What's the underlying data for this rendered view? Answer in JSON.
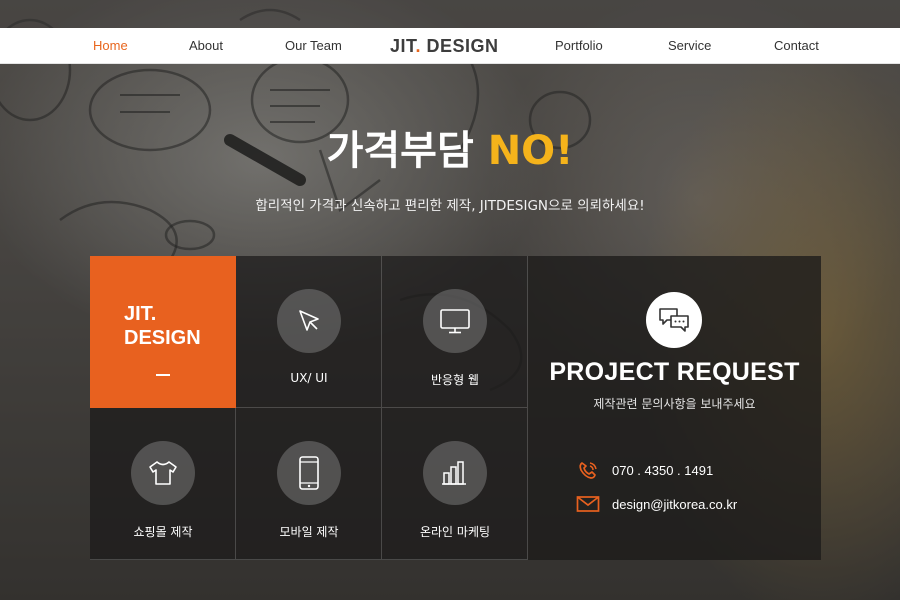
{
  "nav": {
    "items": [
      "Home",
      "About",
      "Our Team",
      "Portfolio",
      "Service",
      "Contact"
    ],
    "active": "Home",
    "logo_text": "JIT",
    "logo_dot": ".",
    "logo_text2": " DESIGN"
  },
  "hero": {
    "title": "가격부담",
    "title_accent": "NO!",
    "subtitle": "합리적인 가격과 신속하고 편리한 제작, JITDESIGN으로 의뢰하세요!"
  },
  "brand_tile": {
    "line1": "JIT",
    "dot": ".",
    "line2": "DESIGN",
    "dash": "—"
  },
  "services": [
    {
      "label": "UX/ UI",
      "icon": "cursor-icon"
    },
    {
      "label": "반응형 웹",
      "icon": "monitor-icon"
    },
    {
      "label": "쇼핑몰 제작",
      "icon": "tshirt-icon"
    },
    {
      "label": "모바일 제작",
      "icon": "smartphone-icon"
    },
    {
      "label": "온라인 마케팅",
      "icon": "bar-chart-hand-icon"
    }
  ],
  "request": {
    "icon": "chat-bubbles-icon",
    "title": "PROJECT REQUEST",
    "subtitle": "제작관련 문의사항을 보내주세요",
    "phone": "070 . 4350 . 1491",
    "email": "design@jitkorea.co.kr"
  },
  "colors": {
    "accent": "#e8611f",
    "headline_accent": "#f5b31b",
    "tile_bg": "#1c1b1a"
  }
}
